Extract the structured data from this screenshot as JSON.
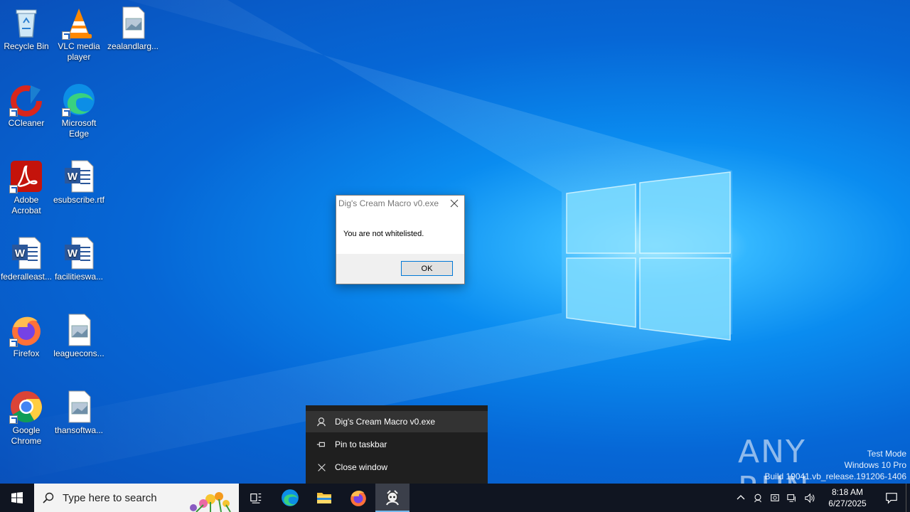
{
  "desktop": {
    "icons": [
      {
        "label": "Recycle Bin",
        "icon": "recycle-bin-icon"
      },
      {
        "label": "VLC media player",
        "icon": "vlc-icon"
      },
      {
        "label": "zealandlarg...",
        "icon": "image-file-icon"
      },
      {
        "label": "CCleaner",
        "icon": "ccleaner-icon"
      },
      {
        "label": "Microsoft Edge",
        "icon": "edge-icon"
      },
      {
        "label": "Adobe Acrobat",
        "icon": "acrobat-icon"
      },
      {
        "label": "esubscribe.rtf",
        "icon": "word-doc-icon"
      },
      {
        "label": "federalleast...",
        "icon": "word-doc-icon"
      },
      {
        "label": "facilitieswa...",
        "icon": "word-doc-icon"
      },
      {
        "label": "Firefox",
        "icon": "firefox-icon"
      },
      {
        "label": "leaguecons...",
        "icon": "image-file-icon"
      },
      {
        "label": "Google Chrome",
        "icon": "chrome-icon"
      },
      {
        "label": "thansoftwa...",
        "icon": "image-file-icon"
      }
    ]
  },
  "dialog": {
    "title": "Dig's Cream Macro v0.exe",
    "message": "You are not whitelisted.",
    "ok_label": "OK"
  },
  "jumplist": {
    "items": [
      {
        "label": "Dig's Cream Macro v0.exe",
        "icon": "app-icon"
      },
      {
        "label": "Pin to taskbar",
        "icon": "pin-icon"
      },
      {
        "label": "Close window",
        "icon": "close-icon"
      }
    ]
  },
  "watermark": {
    "brand": "ANY RUN",
    "line1": "Test Mode",
    "line2": "Windows 10 Pro",
    "line3": "Build 19041.vb_release.191206-1406"
  },
  "taskbar": {
    "search_placeholder": "Type here to search",
    "time": "8:18 AM",
    "date": "6/27/2025"
  },
  "colors": {
    "desktop_blue": "#0a8cf0",
    "taskbar": "#101521",
    "accent": "#0078d7"
  }
}
